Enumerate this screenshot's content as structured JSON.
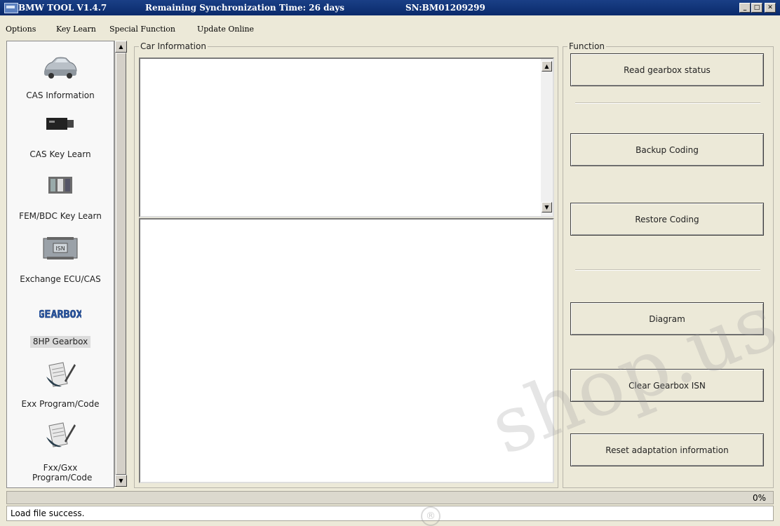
{
  "titlebar": {
    "app_name": "BMW TOOL V1.4.7",
    "remaining": "Remaining Synchronization Time: 26 days",
    "serial": "SN:BM01209299",
    "min_glyph": "_",
    "max_glyph": "□",
    "close_glyph": "✕"
  },
  "menu": {
    "items": [
      "Options",
      "Key Learn",
      "Special Function",
      "Update Online"
    ]
  },
  "sidebar": {
    "items": [
      {
        "label": "CAS Information",
        "icon": "car-icon"
      },
      {
        "label": "CAS Key Learn",
        "icon": "cas-module-icon"
      },
      {
        "label": "FEM/BDC Key Learn",
        "icon": "fem-module-icon"
      },
      {
        "label": "Exchange ECU/CAS",
        "icon": "isn-module-icon",
        "icon_text": "ISN"
      },
      {
        "label": "8HP Gearbox",
        "icon": "gearbox-icon",
        "icon_text": "GEARBOX",
        "selected": true
      },
      {
        "label": "Exx Program/Code",
        "icon": "document-pen-icon"
      },
      {
        "label": "Fxx/Gxx Program/Code",
        "icon": "document-pen-icon"
      }
    ],
    "scroll_up_glyph": "▲",
    "scroll_down_glyph": "▼"
  },
  "car_info": {
    "label": "Car Information",
    "upper_text": "",
    "lower_text": ""
  },
  "function": {
    "label": "Function",
    "buttons": [
      "Read gearbox status",
      "Backup Coding",
      "Restore Coding",
      "Diagram",
      "Clear Gearbox ISN",
      "Reset adaptation information"
    ]
  },
  "progress": {
    "value": 0,
    "label": "0%"
  },
  "status": {
    "message": "Load file success."
  },
  "watermark": {
    "text": "shop.us",
    "registered_glyph": "®"
  },
  "colors": {
    "titlebar": "#0a2a6b",
    "window": "#ece9d8",
    "progress_fill": "#3a6ea5"
  }
}
